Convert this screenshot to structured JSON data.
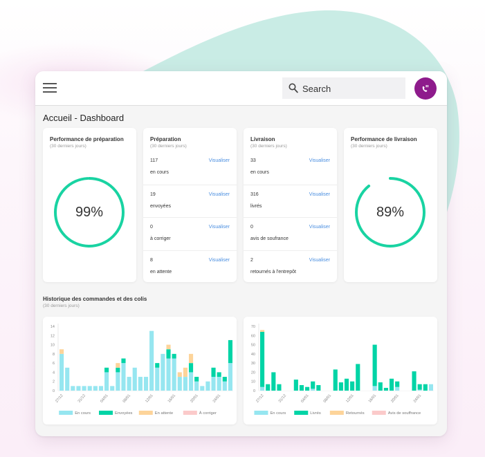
{
  "header": {
    "search_placeholder": "Search",
    "avatar_color": "#8e1b8c"
  },
  "page_title": "Accueil - Dashboard",
  "cards": {
    "prep_perf": {
      "title": "Performance de préparation",
      "subtitle": "(30 derniers jours)",
      "value": 0.99,
      "label": "99%"
    },
    "prep": {
      "title": "Préparation",
      "subtitle": "(30 derniers jours)",
      "rows": [
        {
          "count": "117",
          "label": "en cours",
          "action": "Visualiser"
        },
        {
          "count": "19",
          "label": "envoyées",
          "action": "Visualiser"
        },
        {
          "count": "0",
          "label": "à corriger",
          "action": "Visualiser"
        },
        {
          "count": "8",
          "label": "en attente",
          "action": "Visualiser"
        }
      ]
    },
    "livraison": {
      "title": "Livraison",
      "subtitle": "(30 derniers jours)",
      "rows": [
        {
          "count": "33",
          "label": "en cours",
          "action": "Visualiser"
        },
        {
          "count": "316",
          "label": "livrés",
          "action": "Visualiser"
        },
        {
          "count": "0",
          "label": "avis de soufrance",
          "action": "Visualiser"
        },
        {
          "count": "2",
          "label": "retournés à l'entrepôt",
          "action": "Visualiser"
        }
      ]
    },
    "liv_perf": {
      "title": "Performance de livraison",
      "subtitle": "(30 derniers jours)",
      "value": 0.89,
      "label": "89%"
    }
  },
  "history": {
    "title": "Historique des commandes et des colis",
    "subtitle": "(30 derniers jours)"
  },
  "colors": {
    "accent": "#19d3a2",
    "link": "#4a8ee0",
    "blob": "#c9ece5"
  },
  "chart_data": [
    {
      "type": "bar",
      "stacked": true,
      "title": "",
      "xlabel": "",
      "ylabel": "",
      "ylim": [
        0,
        14
      ],
      "ytick_step": 2,
      "grid": false,
      "legend": "bottom",
      "categories": [
        "27/12",
        "28/12",
        "29/12",
        "30/12",
        "31/12",
        "01/01",
        "02/01",
        "03/01",
        "04/01",
        "05/01",
        "06/01",
        "07/01",
        "08/01",
        "09/01",
        "10/01",
        "11/01",
        "12/01",
        "13/01",
        "14/01",
        "15/01",
        "16/01",
        "17/01",
        "18/01",
        "19/01",
        "20/01",
        "21/01",
        "22/01",
        "23/01",
        "24/01",
        "25/01",
        "26/01"
      ],
      "x_tick_labels": [
        "27/12",
        "31/12",
        "04/01",
        "08/01",
        "12/01",
        "16/01",
        "20/01",
        "24/01"
      ],
      "series": [
        {
          "name": "En cours",
          "color": "#96e6f0",
          "values": [
            8,
            5,
            1,
            1,
            1,
            1,
            1,
            1,
            4,
            1,
            4,
            6,
            3,
            5,
            3,
            3,
            13,
            5,
            8,
            7,
            7,
            3,
            3,
            4,
            2,
            1,
            2,
            3,
            3,
            2,
            6
          ]
        },
        {
          "name": "Envoyées",
          "color": "#00d4a6",
          "values": [
            0,
            0,
            0,
            0,
            0,
            0,
            0,
            0,
            1,
            0,
            1,
            1,
            0,
            0,
            0,
            0,
            0,
            1,
            0,
            2,
            1,
            0,
            0,
            2,
            1,
            0,
            0,
            2,
            1,
            1,
            5
          ]
        },
        {
          "name": "En attente",
          "color": "#fdd49a",
          "values": [
            1,
            0,
            0,
            0,
            0,
            0,
            0,
            0,
            0,
            0,
            1,
            0,
            0,
            0,
            0,
            0,
            0,
            0,
            0,
            1,
            0,
            1,
            2,
            2,
            0,
            0,
            0,
            0,
            0,
            0,
            0
          ]
        },
        {
          "name": "À corriger",
          "color": "#fbcaca",
          "values": [
            0,
            0,
            0,
            0,
            0,
            0,
            0,
            0,
            0,
            0,
            0,
            0,
            0,
            0,
            0,
            0,
            0,
            0,
            0,
            0,
            0,
            0,
            0,
            0,
            0,
            0,
            0,
            0,
            0,
            0,
            0
          ]
        }
      ]
    },
    {
      "type": "bar",
      "stacked": true,
      "title": "",
      "xlabel": "",
      "ylabel": "",
      "ylim": [
        0,
        70
      ],
      "ytick_step": 10,
      "grid": false,
      "legend": "bottom",
      "categories": [
        "27/12",
        "28/12",
        "29/12",
        "30/12",
        "31/12",
        "01/01",
        "02/01",
        "03/01",
        "04/01",
        "05/01",
        "06/01",
        "07/01",
        "08/01",
        "09/01",
        "10/01",
        "11/01",
        "12/01",
        "13/01",
        "14/01",
        "15/01",
        "16/01",
        "17/01",
        "18/01",
        "19/01",
        "20/01",
        "21/01",
        "22/01",
        "23/01",
        "24/01",
        "25/01",
        "26/01"
      ],
      "x_tick_labels": [
        "27/12",
        "31/12",
        "04/01",
        "08/01",
        "12/01",
        "16/01",
        "20/01",
        "24/01"
      ],
      "series": [
        {
          "name": "En cours",
          "color": "#96e6f0",
          "values": [
            4,
            0,
            0,
            0,
            0,
            0,
            0,
            0,
            0,
            2,
            0,
            0,
            0,
            0,
            0,
            0,
            0,
            0,
            0,
            0,
            5,
            0,
            0,
            0,
            4,
            0,
            0,
            0,
            1,
            0,
            7
          ]
        },
        {
          "name": "Livrés",
          "color": "#00d4a6",
          "values": [
            60,
            7,
            20,
            7,
            0,
            0,
            12,
            6,
            4,
            8,
            6,
            0,
            0,
            23,
            9,
            13,
            10,
            29,
            0,
            0,
            45,
            9,
            3,
            13,
            6,
            0,
            0,
            21,
            6,
            7,
            0
          ]
        },
        {
          "name": "Retournés",
          "color": "#fdd49a",
          "values": [
            2,
            0,
            0,
            0,
            0,
            0,
            0,
            0,
            0,
            0,
            0,
            0,
            0,
            0,
            0,
            0,
            0,
            0,
            0,
            0,
            0,
            0,
            0,
            0,
            0,
            0,
            0,
            0,
            0,
            0,
            0
          ]
        },
        {
          "name": "Avis de souffrance",
          "color": "#fbcaca",
          "values": [
            0,
            0,
            0,
            0,
            0,
            0,
            0,
            0,
            0,
            0,
            0,
            0,
            0,
            0,
            0,
            0,
            0,
            0,
            0,
            0,
            0,
            0,
            0,
            0,
            0,
            0,
            0,
            0,
            0,
            0,
            0
          ]
        }
      ]
    }
  ]
}
